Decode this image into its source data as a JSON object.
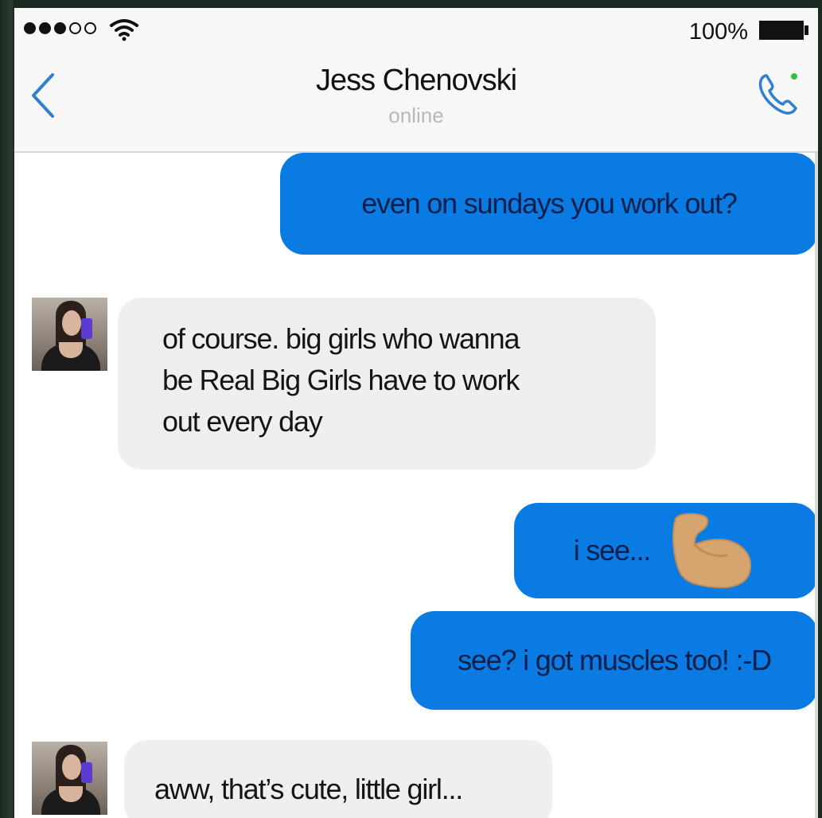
{
  "status_bar": {
    "battery_percent": "100%"
  },
  "header": {
    "contact_name": "Jess Chenovski",
    "contact_status": "online"
  },
  "colors": {
    "outgoing_bubble": "#0a7be3",
    "incoming_bubble": "#efefef",
    "accent": "#2f80d1"
  },
  "messages": [
    {
      "direction": "outgoing",
      "text": "even on sundays you work out?"
    },
    {
      "direction": "incoming",
      "lines": [
        "of course. big girls who wanna",
        "be Real Big Girls have to work",
        "out every day"
      ]
    },
    {
      "direction": "outgoing",
      "text": "i see...",
      "emoji": "flexed-biceps"
    },
    {
      "direction": "outgoing",
      "text": "see? i got muscles too! :-D"
    },
    {
      "direction": "incoming",
      "text": "aww, that’s cute, little girl..."
    }
  ]
}
